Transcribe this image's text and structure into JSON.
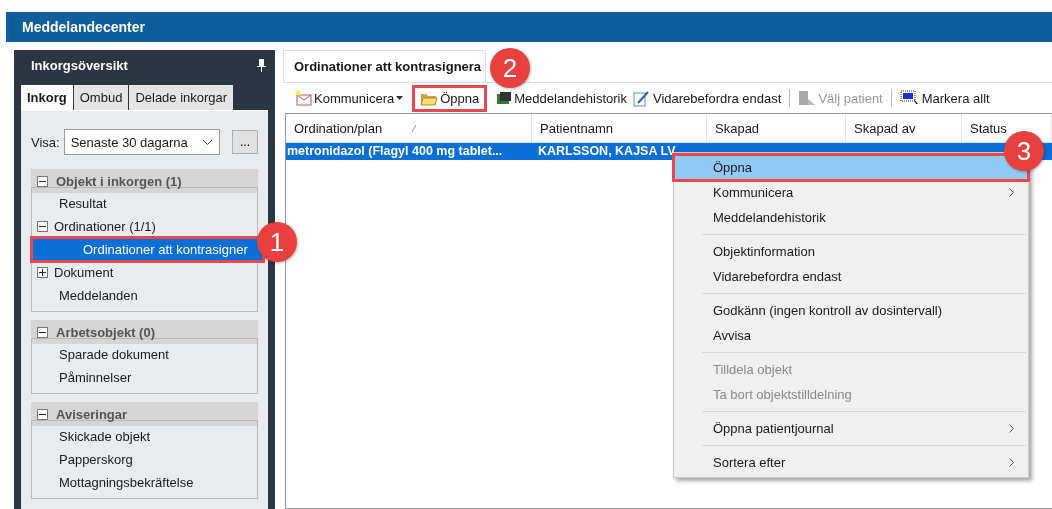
{
  "window": {
    "title": "Meddelandecenter"
  },
  "sidebar": {
    "title": "Inkorgsöversikt",
    "tabs": [
      {
        "label": "Inkorg",
        "selected": true
      },
      {
        "label": "Ombud",
        "selected": false
      },
      {
        "label": "Delade inkorgar",
        "selected": false
      }
    ],
    "filter": {
      "label": "Visa:",
      "value": "Senaste 30 dagarna",
      "button": "..."
    },
    "sections": [
      {
        "title": "Objekt i inkorgen (1)",
        "expanded": true,
        "items": [
          {
            "label": "Resultat",
            "selected": false
          },
          {
            "label": "Ordinationer (1/1)",
            "expanded": true,
            "selected": false,
            "children": [
              {
                "label": "Ordinationer att kontrasigner",
                "selected": true,
                "highlighted": true
              }
            ]
          },
          {
            "label": "Dokument",
            "expanded": false,
            "selected": false
          },
          {
            "label": "Meddelanden",
            "selected": false
          }
        ]
      },
      {
        "title": "Arbetsobjekt (0)",
        "expanded": true,
        "items": [
          {
            "label": "Sparade dokument",
            "selected": false
          },
          {
            "label": "Påminnelser",
            "selected": false
          }
        ]
      },
      {
        "title": "Aviseringar",
        "expanded": true,
        "items": [
          {
            "label": "Skickade objekt",
            "selected": false
          },
          {
            "label": "Papperskorg",
            "selected": false
          },
          {
            "label": "Mottagningsbekräftelse",
            "selected": false
          }
        ]
      }
    ]
  },
  "main": {
    "tab": "Ordinationer att kontrasignera",
    "toolbar": [
      [
        {
          "label": "Kommunicera",
          "kind": "dropdown",
          "disabled": false,
          "highlighted": false
        }
      ],
      [
        {
          "label": "Öppna",
          "kind": "button",
          "disabled": false,
          "highlighted": true
        },
        {
          "label": "Meddelandehistorik",
          "kind": "button",
          "disabled": false,
          "highlighted": false
        },
        {
          "label": "Vidarebefordra endast",
          "kind": "button",
          "disabled": false,
          "highlighted": false
        }
      ],
      [
        {
          "label": "Välj patient",
          "kind": "button",
          "disabled": true,
          "highlighted": false
        }
      ],
      [
        {
          "label": "Markera allt",
          "kind": "button",
          "disabled": false,
          "highlighted": false
        }
      ]
    ],
    "table": {
      "columns": [
        "Ordination/plan",
        "Patientnamn",
        "Skapad",
        "Skapad av",
        "Status"
      ],
      "rows": [
        {
          "selected": true,
          "cells": [
            "metronidazol (Flagyl 400 mg tablet...",
            "KARLSSON, KAJSA LV",
            "",
            "",
            ""
          ]
        }
      ]
    }
  },
  "context_menu": [
    [
      {
        "label": "Öppna",
        "selected": true,
        "highlighted": true,
        "disabled": false,
        "submenu": false
      },
      {
        "label": "Kommunicera",
        "selected": false,
        "highlighted": false,
        "disabled": false,
        "submenu": true
      },
      {
        "label": "Meddelandehistorik",
        "selected": false,
        "highlighted": false,
        "disabled": false,
        "submenu": false
      }
    ],
    [
      {
        "label": "Objektinformation",
        "selected": false,
        "highlighted": false,
        "disabled": false,
        "submenu": false
      },
      {
        "label": "Vidarebefordra endast",
        "selected": false,
        "highlighted": false,
        "disabled": false,
        "submenu": false
      }
    ],
    [
      {
        "label": "Godkänn (ingen kontroll av dosintervall)",
        "selected": false,
        "highlighted": false,
        "disabled": false,
        "submenu": false
      },
      {
        "label": "Avvisa",
        "selected": false,
        "highlighted": false,
        "disabled": false,
        "submenu": false
      }
    ],
    [
      {
        "label": "Tilldela objekt",
        "selected": false,
        "highlighted": false,
        "disabled": true,
        "submenu": false
      },
      {
        "label": "Ta bort objektstilldelning",
        "selected": false,
        "highlighted": false,
        "disabled": true,
        "submenu": false
      }
    ],
    [
      {
        "label": "Öppna patientjournal",
        "selected": false,
        "highlighted": false,
        "disabled": false,
        "submenu": true
      }
    ],
    [
      {
        "label": "Sortera efter",
        "selected": false,
        "highlighted": false,
        "disabled": false,
        "submenu": true
      }
    ]
  ],
  "callouts": [
    {
      "label": "1"
    },
    {
      "label": "2"
    },
    {
      "label": "3"
    }
  ]
}
